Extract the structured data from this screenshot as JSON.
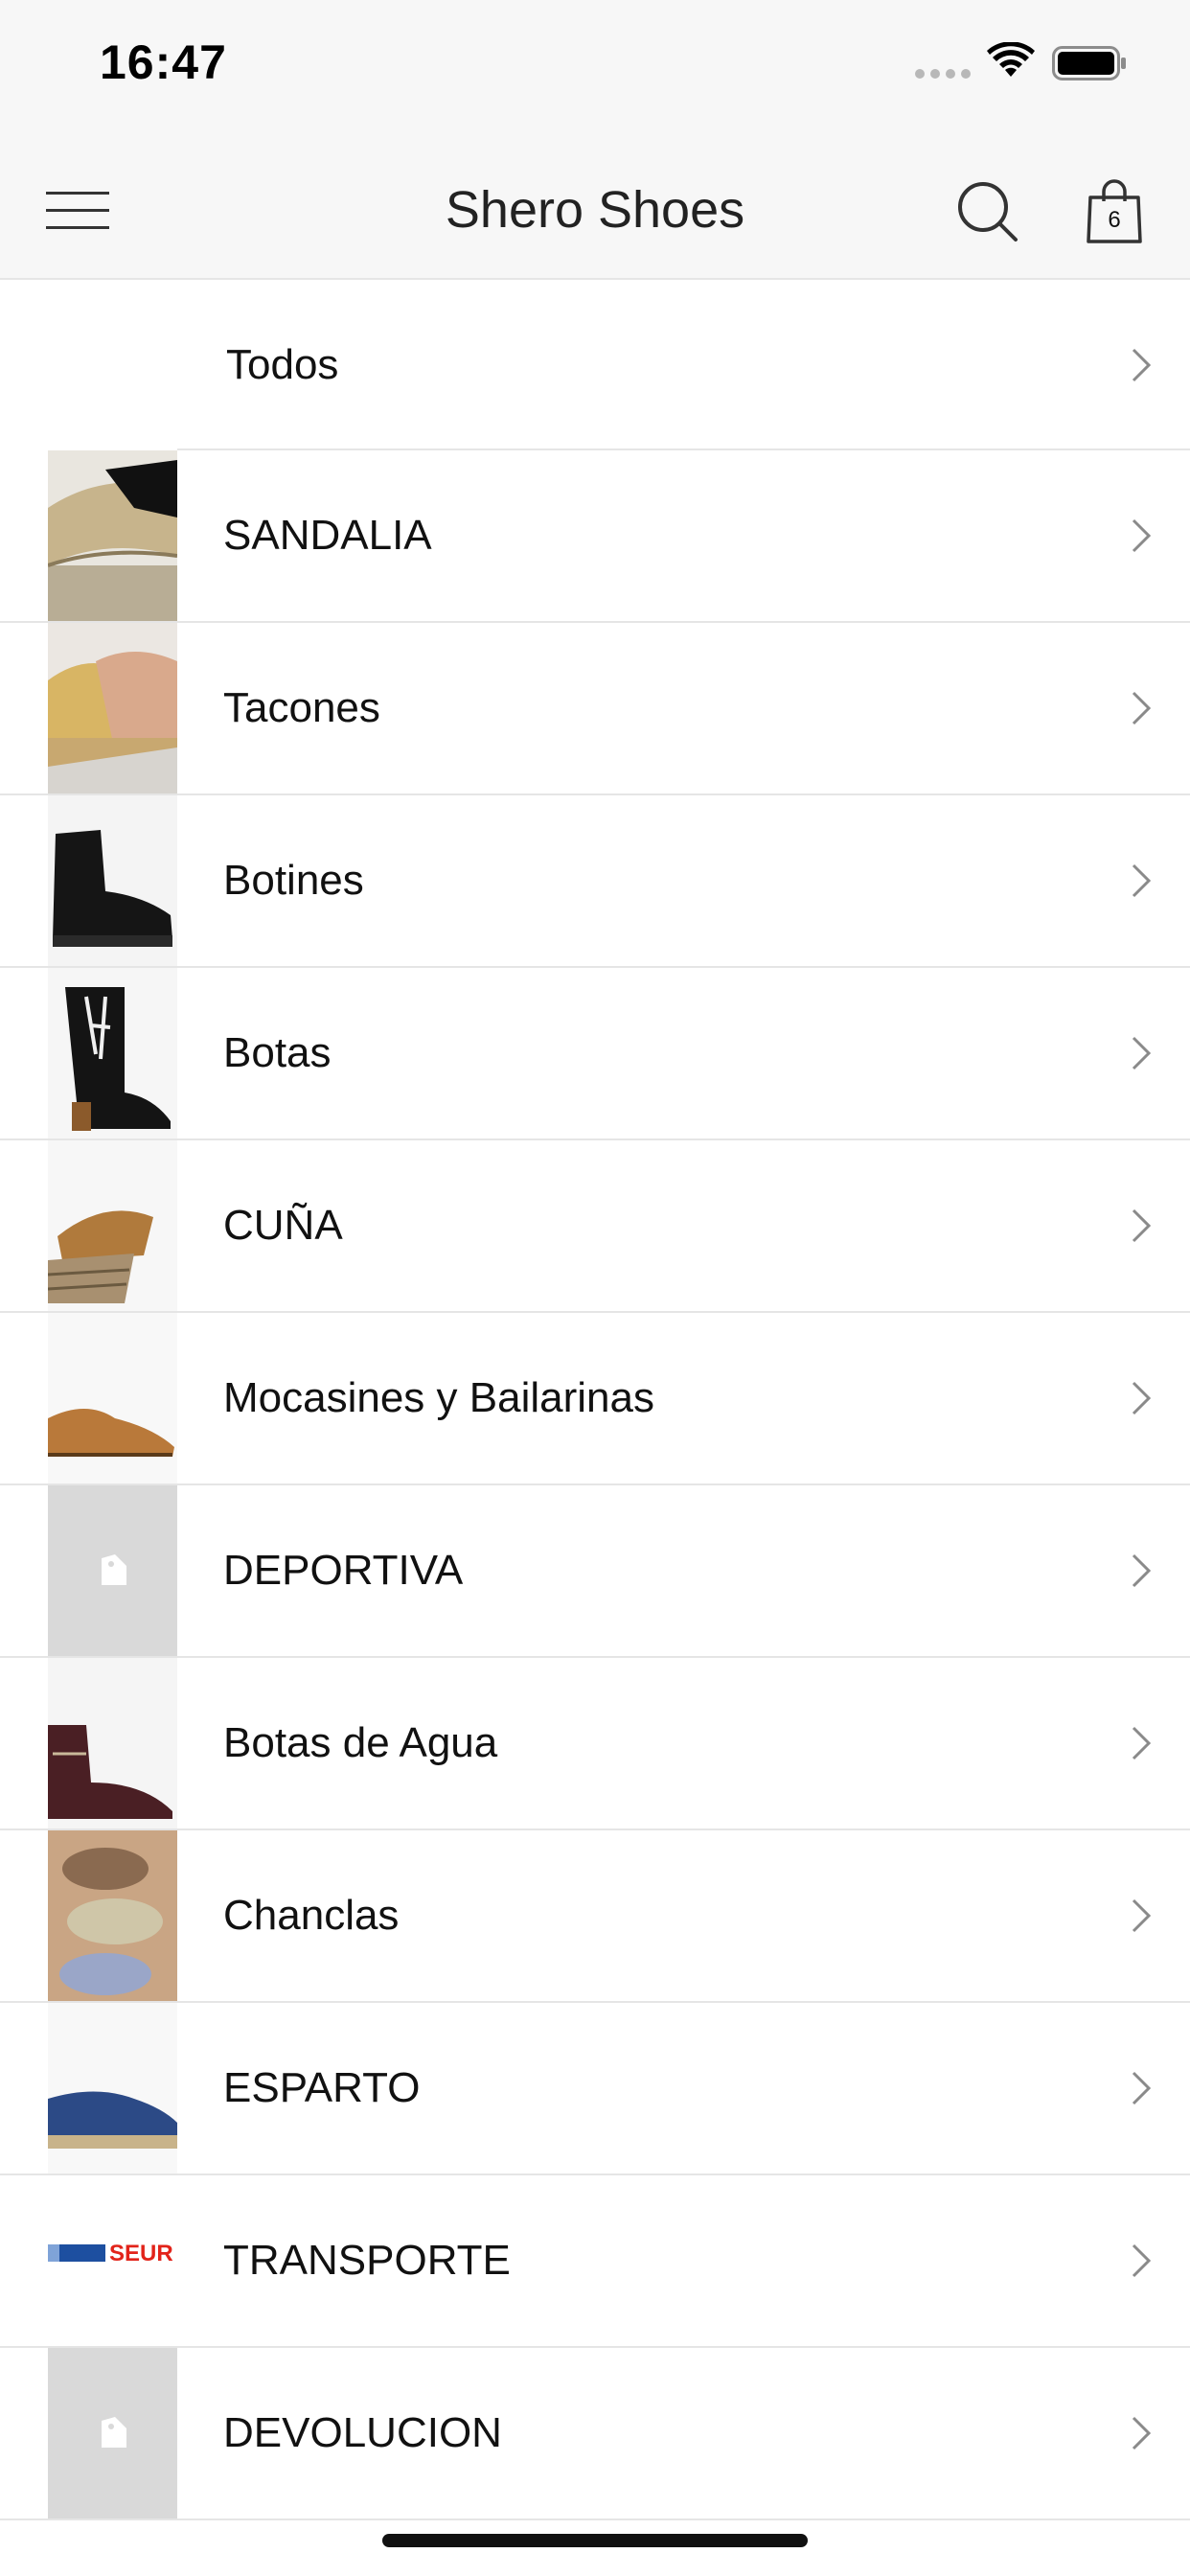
{
  "status_bar": {
    "time": "16:47"
  },
  "nav": {
    "title": "Shero Shoes",
    "cart_count": "6"
  },
  "categories": [
    {
      "label": "Todos",
      "icon": "none"
    },
    {
      "label": "SANDALIA",
      "icon": "sandal-photo"
    },
    {
      "label": "Tacones",
      "icon": "heels-photo"
    },
    {
      "label": "Botines",
      "icon": "ankle-boot-photo"
    },
    {
      "label": "Botas",
      "icon": "cowboy-boot-photo"
    },
    {
      "label": "CUÑA",
      "icon": "wedge-photo"
    },
    {
      "label": "Mocasines y Bailarinas",
      "icon": "flat-shoe-photo"
    },
    {
      "label": "DEPORTIVA",
      "icon": "tag-placeholder"
    },
    {
      "label": "Botas de Agua",
      "icon": "rain-boot-photo"
    },
    {
      "label": "Chanclas",
      "icon": "slides-photo"
    },
    {
      "label": "ESPARTO",
      "icon": "espadrille-photo"
    },
    {
      "label": "TRANSPORTE",
      "icon": "seur-logo",
      "logo_text": "SEUR"
    },
    {
      "label": "DEVOLUCION",
      "icon": "tag-placeholder"
    }
  ],
  "colors": {
    "bar_background": "#f7f7f7",
    "separator": "#e5e5e5",
    "placeholder_gray": "#d9d9d9",
    "seur_blue": "#1d4fa0",
    "seur_red": "#e2231a"
  }
}
